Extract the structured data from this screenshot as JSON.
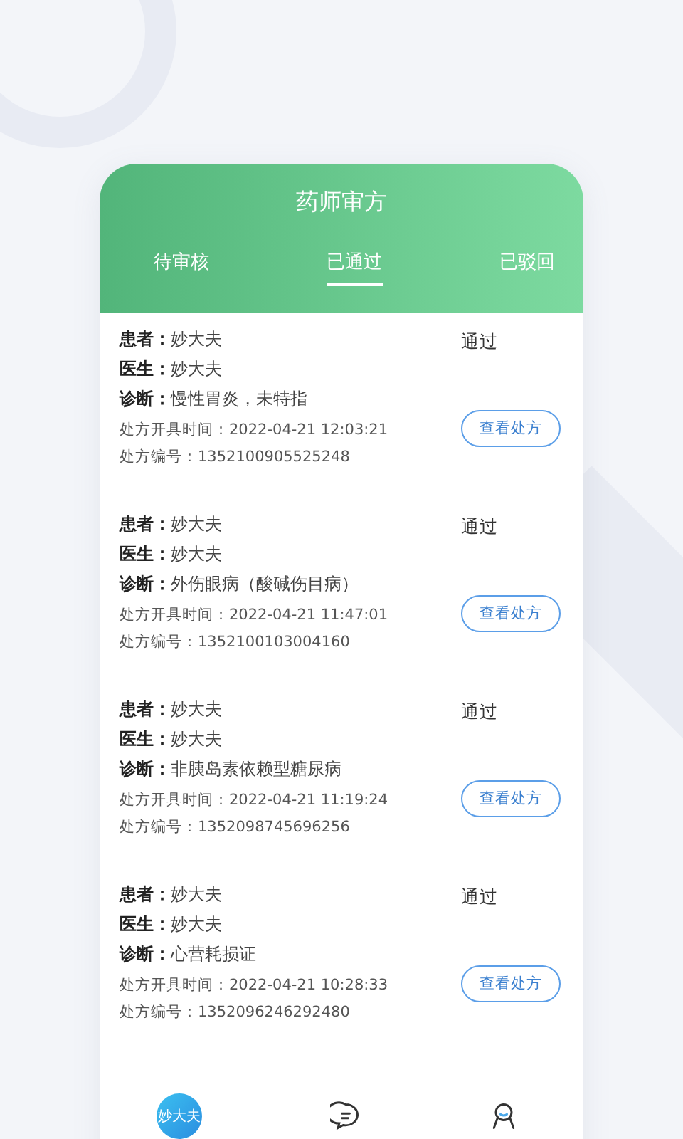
{
  "header": {
    "title": "药师审方"
  },
  "tabs": [
    {
      "label": "待审核",
      "selected": false
    },
    {
      "label": "已通过",
      "selected": true
    },
    {
      "label": "已驳回",
      "selected": false
    }
  ],
  "records": [
    {
      "patient_label": "患者：",
      "patient": "妙大夫",
      "doctor_label": "医生：",
      "doctor": "妙大夫",
      "diagnosis_label": "诊断：",
      "diagnosis": "慢性胃炎，未特指",
      "time": "处方开具时间：2022-04-21 12:03:21",
      "number": "处方编号：1352100905525248",
      "status": "通过",
      "button": "查看处方"
    },
    {
      "patient_label": "患者：",
      "patient": "妙大夫",
      "doctor_label": "医生：",
      "doctor": "妙大夫",
      "diagnosis_label": "诊断：",
      "diagnosis": "外伤眼病（酸碱伤目病）",
      "time": "处方开具时间：2022-04-21 11:47:01",
      "number": "处方编号：1352100103004160",
      "status": "通过",
      "button": "查看处方"
    },
    {
      "patient_label": "患者：",
      "patient": "妙大夫",
      "doctor_label": "医生：",
      "doctor": "妙大夫",
      "diagnosis_label": "诊断：",
      "diagnosis": "非胰岛素依赖型糖尿病",
      "time": "处方开具时间：2022-04-21 11:19:24",
      "number": "处方编号：1352098745696256",
      "status": "通过",
      "button": "查看处方"
    },
    {
      "patient_label": "患者：",
      "patient": "妙大夫",
      "doctor_label": "医生：",
      "doctor": "妙大夫",
      "diagnosis_label": "诊断：",
      "diagnosis": "心营耗损证",
      "time": "处方开具时间：2022-04-21 10:28:33",
      "number": "处方编号：1352096246292480",
      "status": "通过",
      "button": "查看处方"
    }
  ],
  "bottom_nav": [
    {
      "kind": "logo",
      "label": "妙大夫",
      "selected": true
    },
    {
      "kind": "chat",
      "selected": false
    },
    {
      "kind": "profile",
      "selected": false
    }
  ]
}
